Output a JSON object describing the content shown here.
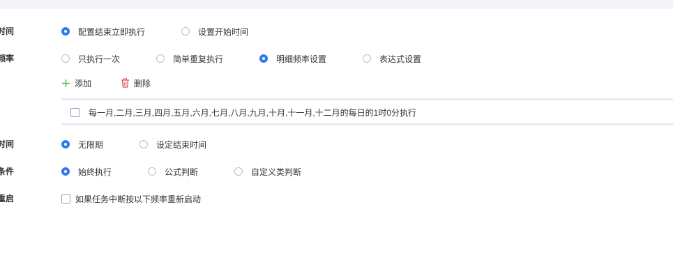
{
  "top": {
    "clip_text": ""
  },
  "start_time": {
    "label": "时间",
    "options": [
      {
        "label": "配置结束立即执行",
        "checked": true
      },
      {
        "label": "设置开始时间",
        "checked": false
      }
    ]
  },
  "frequency": {
    "label": "频率",
    "options": [
      {
        "label": "只执行一次",
        "checked": false
      },
      {
        "label": "简单重复执行",
        "checked": false
      },
      {
        "label": "明细频率设置",
        "checked": true
      },
      {
        "label": "表达式设置",
        "checked": false
      }
    ],
    "add_label": "添加",
    "delete_label": "删除",
    "items": [
      {
        "text": "每一月,二月,三月,四月,五月,六月,七月,八月,九月,十月,十一月,十二月的每日的1时0分执行",
        "checked": false
      }
    ]
  },
  "end_time": {
    "label": "时间",
    "options": [
      {
        "label": "无限期",
        "checked": true
      },
      {
        "label": "设定结束时间",
        "checked": false
      }
    ]
  },
  "condition": {
    "label": "条件",
    "options": [
      {
        "label": "始终执行",
        "checked": true
      },
      {
        "label": "公式判断",
        "checked": false
      },
      {
        "label": "自定义类判断",
        "checked": false
      }
    ]
  },
  "restart": {
    "label": "重启",
    "checkbox_label": "如果任务中断按以下频率重新启动",
    "checked": false
  },
  "colors": {
    "accent": "#2f78ee",
    "add_icon": "#3bb34a",
    "delete_icon": "#e0485a",
    "divider": "#e4ebf5"
  }
}
